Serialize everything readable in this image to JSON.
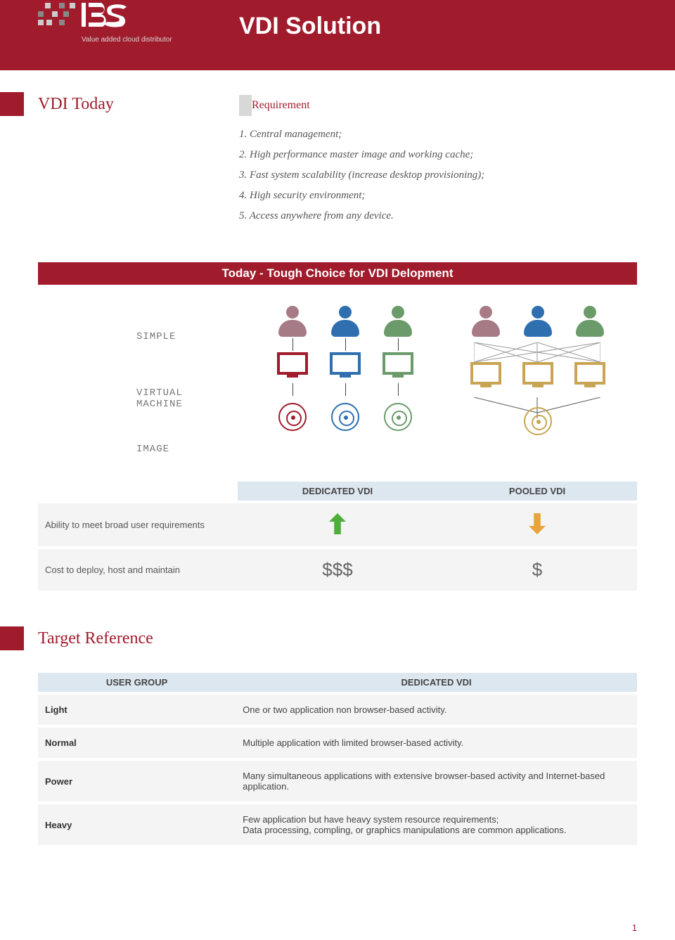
{
  "logo": {
    "tagline": "Value added cloud distributor"
  },
  "header": {
    "title": "VDI Solution"
  },
  "section_vdi_today": {
    "title": "VDI Today",
    "requirement_label": "Requirement",
    "requirements": [
      "1. Central management;",
      "2. High performance master image and working cache;",
      "3. Fast system scalability (increase desktop provisioning);",
      "4. High security environment;",
      "5. Access anywhere from any device."
    ]
  },
  "banner": "Today - Tough Choice for VDI Delopment",
  "diagram": {
    "label_simple": "SIMPLE",
    "label_vm": "VIRTUAL MACHINE",
    "label_image": "IMAGE"
  },
  "comparison": {
    "col_dedicated": "DEDICATED VDI",
    "col_pooled": "POOLED VDI",
    "row_ability": "Ability to meet broad user requirements",
    "row_cost": "Cost to deploy, host and maintain",
    "cost_dedicated": "$$$",
    "cost_pooled": "$"
  },
  "section_target": {
    "title": "Target Reference",
    "col_user_group": "USER GROUP",
    "col_dedicated": "DEDICATED VDI",
    "rows": [
      {
        "group": "Light",
        "desc": "One or two application non browser-based activity."
      },
      {
        "group": "Normal",
        "desc": "Multiple application with limited browser-based activity."
      },
      {
        "group": "Power",
        "desc": "Many simultaneous applications with extensive browser-based activity and Internet-based application."
      },
      {
        "group": "Heavy",
        "desc": "Few application but have heavy system resource requirements;\nData processing, compling, or graphics manipulations are common applications."
      }
    ]
  },
  "page_number": "1"
}
